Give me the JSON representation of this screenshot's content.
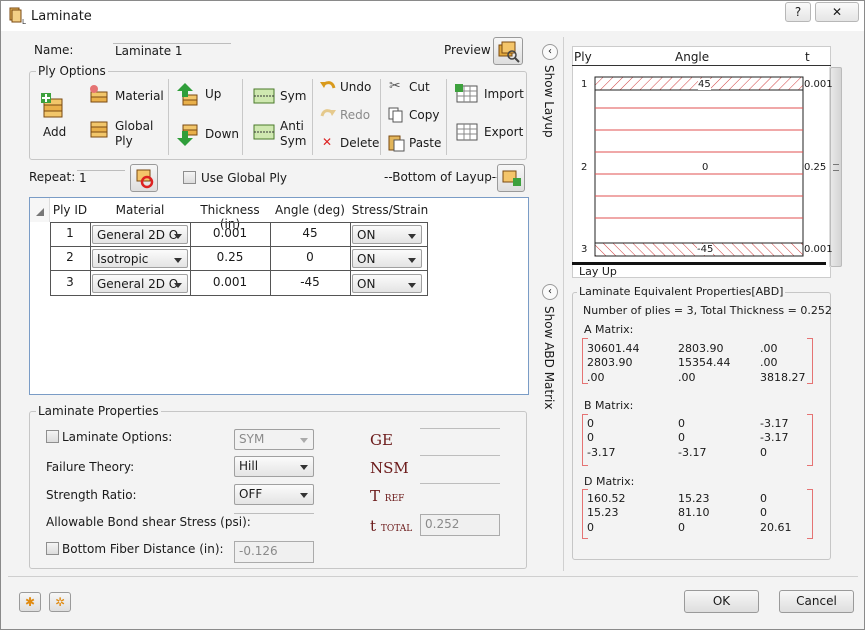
{
  "window": {
    "title": "Laminate",
    "help": "?",
    "close": "✕"
  },
  "name": {
    "label": "Name:",
    "value": "Laminate 1"
  },
  "preview": {
    "label": "Preview"
  },
  "ply_options": {
    "title": "Ply Options",
    "add": "Add",
    "material": "Material",
    "global_ply": "Global\nPly",
    "up": "Up",
    "down": "Down",
    "sym": "Sym",
    "anti_sym": "Anti\nSym",
    "undo": "Undo",
    "redo": "Redo",
    "delete": "Delete",
    "cut": "Cut",
    "copy": "Copy",
    "paste": "Paste",
    "import": "Import",
    "export": "Export"
  },
  "repeat": {
    "label": "Repeat:",
    "value": "1"
  },
  "use_global_ply": "Use Global Ply",
  "bottom_of_layup": "--Bottom of Layup--",
  "table": {
    "headers": [
      "Ply ID",
      "Material",
      "Thickness (in)",
      "Angle (deg)",
      "Stress/Strain"
    ],
    "rows": [
      {
        "id": "1",
        "material": "General 2D O",
        "thickness": "0.001",
        "angle": "45",
        "ss": "ON"
      },
      {
        "id": "2",
        "material": "Isotropic",
        "thickness": "0.25",
        "angle": "0",
        "ss": "ON"
      },
      {
        "id": "3",
        "material": "General 2D O",
        "thickness": "0.001",
        "angle": "-45",
        "ss": "ON"
      }
    ]
  },
  "laminate_properties": {
    "title": "Laminate Properties",
    "laminate_options": "Laminate Options:",
    "laminate_options_value": "SYM",
    "failure_theory": "Failure Theory:",
    "failure_theory_value": "Hill",
    "strength_ratio": "Strength Ratio:",
    "strength_ratio_value": "OFF",
    "bond_shear": "Allowable Bond shear Stress (psi):",
    "bottom_fiber": "Bottom Fiber Distance (in):",
    "bottom_fiber_value": "-0.126",
    "ge": "GE",
    "nsm": "NSM",
    "tref": "T",
    "tref_sub": "REF",
    "ttotal": "t",
    "ttotal_sub": "TOTAL",
    "ttotal_value": "0.252"
  },
  "side_tabs": {
    "show_layup": "Show Layup",
    "show_abd": "Show ABD Matrix"
  },
  "layup": {
    "col_ply": "Ply",
    "col_angle": "Angle",
    "col_t": "t",
    "plies": [
      {
        "id": "1",
        "angle": "45",
        "t": "0.001"
      },
      {
        "id": "2",
        "angle": "0",
        "t": "0.25"
      },
      {
        "id": "3",
        "angle": "-45",
        "t": "0.001"
      }
    ],
    "lay_up": "Lay Up"
  },
  "abd": {
    "title": "Laminate Equivalent Properties[ABD]",
    "summary": "Number of plies = 3, Total Thickness = 0.252",
    "a_label": "A Matrix:",
    "a": [
      [
        "30601.44",
        "2803.90",
        ".00"
      ],
      [
        "2803.90",
        "15354.44",
        ".00"
      ],
      [
        ".00",
        ".00",
        "3818.27"
      ]
    ],
    "b_label": "B Matrix:",
    "b": [
      [
        "0",
        "0",
        "-3.17"
      ],
      [
        "0",
        "0",
        "-3.17"
      ],
      [
        "-3.17",
        "-3.17",
        "0"
      ]
    ],
    "d_label": "D Matrix:",
    "d": [
      [
        "160.52",
        "15.23",
        "0"
      ],
      [
        "15.23",
        "81.10",
        "0"
      ],
      [
        "0",
        "0",
        "20.61"
      ]
    ]
  },
  "footer": {
    "ok": "OK",
    "cancel": "Cancel"
  }
}
